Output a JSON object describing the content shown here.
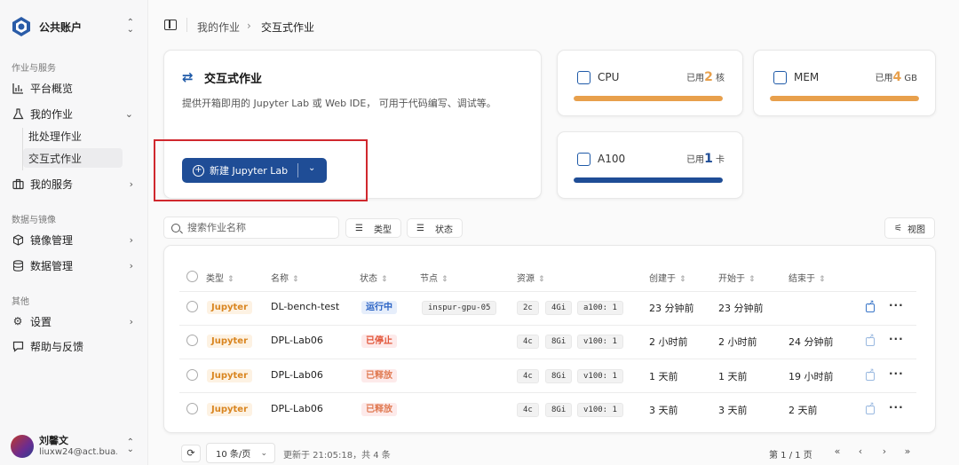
{
  "sidebar": {
    "account": "公共账户",
    "sections": [
      "作业与服务",
      "数据与镜像",
      "其他"
    ],
    "items": [
      {
        "label": "平台概览"
      },
      {
        "label": "我的作业"
      },
      {
        "label": "我的服务"
      },
      {
        "label": "镜像管理"
      },
      {
        "label": "数据管理"
      },
      {
        "label": "设置"
      },
      {
        "label": "帮助与反馈"
      }
    ],
    "sub_items": [
      "批处理作业",
      "交互式作业"
    ],
    "user": {
      "name": "刘馨文",
      "email": "liuxw24@act.bua..."
    }
  },
  "header": {
    "crumbs": [
      "我的作业",
      "交互式作业"
    ]
  },
  "hero": {
    "title": "交互式作业",
    "desc": "提供开箱即用的 Jupyter Lab 或 Web IDE， 可用于代码编写、调试等。",
    "button": "新建 Jupyter Lab"
  },
  "resources": [
    {
      "name": "CPU",
      "used_prefix": "已用",
      "value": "2",
      "unit": "核",
      "fill": 1.0,
      "color": "#e8a04c"
    },
    {
      "name": "MEM",
      "used_prefix": "已用",
      "value": "4",
      "unit": "GB",
      "fill": 1.0,
      "color": "#e8a04c"
    },
    {
      "name": "A100",
      "used_prefix": "已用",
      "value": "1",
      "unit": "卡",
      "fill": 1.0,
      "color": "#1f4d96"
    }
  ],
  "toolbar": {
    "search_placeholder": "搜索作业名称",
    "filter_type": "类型",
    "filter_status": "状态",
    "view": "视图"
  },
  "table": {
    "columns": [
      "类型",
      "名称",
      "状态",
      "节点",
      "资源",
      "创建于",
      "开始于",
      "结束于"
    ],
    "rows": [
      {
        "type": "Jupyter",
        "name": "DL-bench-test",
        "status": "运行中",
        "status_kind": "run",
        "node": "inspur-gpu-05",
        "res": [
          "2c",
          "4Gi",
          "a100: 1"
        ],
        "created": "23 分钟前",
        "started": "23 分钟前",
        "ended": ""
      },
      {
        "type": "Jupyter",
        "name": "DPL-Lab06",
        "status": "已停止",
        "status_kind": "stop",
        "node": "",
        "res": [
          "4c",
          "8Gi",
          "v100: 1"
        ],
        "created": "2 小时前",
        "started": "2 小时前",
        "ended": "24 分钟前"
      },
      {
        "type": "Jupyter",
        "name": "DPL-Lab06",
        "status": "已释放",
        "status_kind": "rel",
        "node": "",
        "res": [
          "4c",
          "8Gi",
          "v100: 1"
        ],
        "created": "1 天前",
        "started": "1 天前",
        "ended": "19 小时前"
      },
      {
        "type": "Jupyter",
        "name": "DPL-Lab06",
        "status": "已释放",
        "status_kind": "rel",
        "node": "",
        "res": [
          "4c",
          "8Gi",
          "v100: 1"
        ],
        "created": "3 天前",
        "started": "3 天前",
        "ended": "2 天前"
      }
    ]
  },
  "footer": {
    "page_size": "10 条/页",
    "updated": "更新于 21:05:18，共 4 条",
    "page_info": "第 1 / 1 页"
  },
  "colors": {
    "primary": "#1f4d96",
    "accent": "#e8a04c",
    "highlight": "#d0282e"
  }
}
